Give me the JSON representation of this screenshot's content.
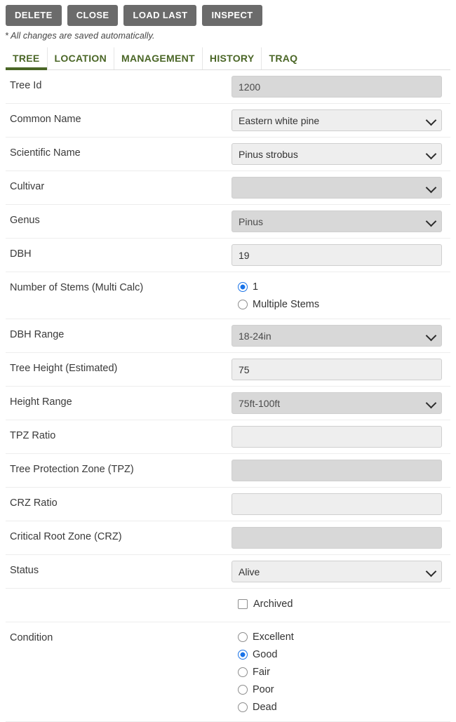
{
  "toolbar": {
    "buttons": [
      {
        "label": "DELETE",
        "name": "delete-button"
      },
      {
        "label": "CLOSE",
        "name": "close-button"
      },
      {
        "label": "LOAD LAST",
        "name": "load-last-button"
      },
      {
        "label": "INSPECT",
        "name": "inspect-button"
      }
    ]
  },
  "note": "* All changes are saved automatically.",
  "tabs": [
    {
      "label": "TREE",
      "active": true
    },
    {
      "label": "LOCATION",
      "active": false
    },
    {
      "label": "MANAGEMENT",
      "active": false
    },
    {
      "label": "HISTORY",
      "active": false
    },
    {
      "label": "TRAQ",
      "active": false
    }
  ],
  "colors": {
    "tab_accent": "#4a6626",
    "button_bg": "#6b6b6b",
    "radio_selected": "#1a73e8",
    "field_enabled_bg": "#eeeeee",
    "field_disabled_bg": "#d8d8d8"
  },
  "form": {
    "tree_id": {
      "label": "Tree Id",
      "value": "1200"
    },
    "common_name": {
      "label": "Common Name",
      "value": "Eastern white pine"
    },
    "scientific_name": {
      "label": "Scientific Name",
      "value": "Pinus strobus"
    },
    "cultivar": {
      "label": "Cultivar",
      "value": ""
    },
    "genus": {
      "label": "Genus",
      "value": "Pinus"
    },
    "dbh": {
      "label": "DBH",
      "value": "19"
    },
    "stems": {
      "label": "Number of Stems (Multi Calc)",
      "options": [
        {
          "label": "1",
          "selected": true
        },
        {
          "label": "Multiple Stems",
          "selected": false
        }
      ]
    },
    "dbh_range": {
      "label": "DBH Range",
      "value": "18-24in"
    },
    "tree_height": {
      "label": "Tree Height (Estimated)",
      "value": "75"
    },
    "height_range": {
      "label": "Height Range",
      "value": "75ft-100ft"
    },
    "tpz_ratio": {
      "label": "TPZ Ratio",
      "value": ""
    },
    "tpz": {
      "label": "Tree Protection Zone (TPZ)",
      "value": ""
    },
    "crz_ratio": {
      "label": "CRZ Ratio",
      "value": ""
    },
    "crz": {
      "label": "Critical Root Zone (CRZ)",
      "value": ""
    },
    "status": {
      "label": "Status",
      "value": "Alive"
    },
    "archived": {
      "label": "Archived",
      "checked": false
    },
    "condition": {
      "label": "Condition",
      "options": [
        {
          "label": "Excellent",
          "selected": false
        },
        {
          "label": "Good",
          "selected": true
        },
        {
          "label": "Fair",
          "selected": false
        },
        {
          "label": "Poor",
          "selected": false
        },
        {
          "label": "Dead",
          "selected": false
        }
      ]
    }
  }
}
